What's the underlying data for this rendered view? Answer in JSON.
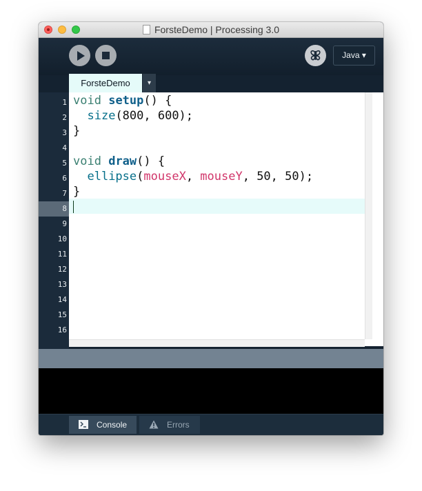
{
  "window": {
    "title": "ForsteDemo | Processing 3.0"
  },
  "toolbar": {
    "run_icon": "play-icon",
    "stop_icon": "stop-icon",
    "debug_icon": "butterfly-icon",
    "mode": "Java ▾"
  },
  "tabs": [
    {
      "label": "ForsteDemo"
    }
  ],
  "tab_menu_glyph": "▾",
  "editor": {
    "current_line": 8,
    "line_numbers": [
      "1",
      "2",
      "3",
      "4",
      "5",
      "6",
      "7",
      "8",
      "9",
      "10",
      "11",
      "12",
      "13",
      "14",
      "15",
      "16"
    ],
    "lines": [
      "void setup() {",
      "  size(800, 600);",
      "}",
      "",
      "void draw() {",
      "  ellipse(mouseX, mouseY, 50, 50);",
      "}",
      ""
    ],
    "tokens": {
      "void1": "void",
      "setup": "setup",
      "setup_rest": "() {",
      "size": "size",
      "size_rest": "(800, 600);",
      "close1": "}",
      "void2": "void",
      "draw": "draw",
      "draw_rest": "() {",
      "ellipse": "ellipse",
      "paren": "(",
      "mouseX": "mouseX",
      "comma1": ", ",
      "mouseY": "mouseY",
      "ellipse_rest": ", 50, 50);",
      "close2": "}"
    }
  },
  "footer": {
    "console_label": "Console",
    "errors_label": "Errors"
  },
  "colors": {
    "toolbar_bg": "#142230",
    "tab_active": "#e5fbf9",
    "keyword": "#3a7f71",
    "function": "#0f5f8a",
    "variable": "#d1356a",
    "current_line_bg": "#e6fbfa"
  }
}
